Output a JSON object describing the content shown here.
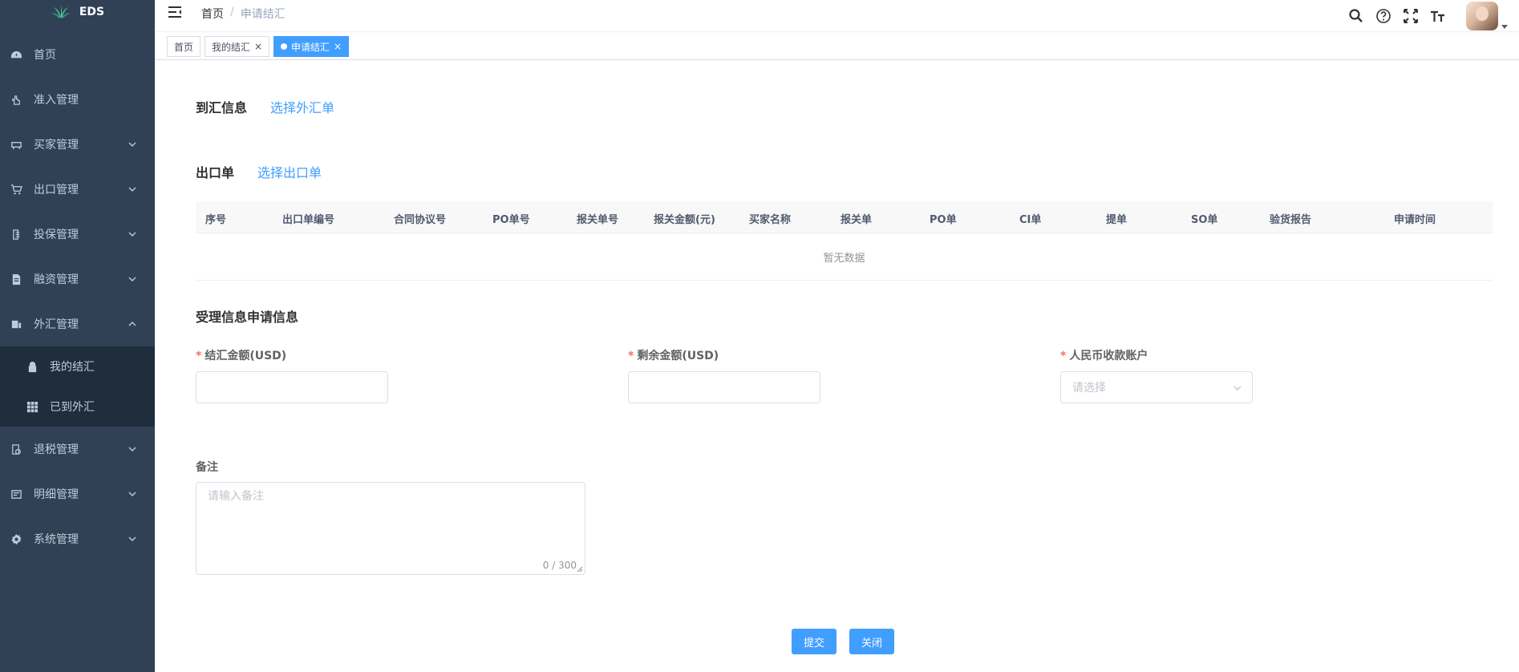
{
  "app": {
    "logo_text": "EDS"
  },
  "sidebar": {
    "items": [
      {
        "label": "首页",
        "icon": "dashboard-icon",
        "has_children": false
      },
      {
        "label": "准入管理",
        "icon": "hand-icon",
        "has_children": false
      },
      {
        "label": "买家管理",
        "icon": "buyer-icon",
        "has_children": true
      },
      {
        "label": "出口管理",
        "icon": "cart-icon",
        "has_children": true
      },
      {
        "label": "投保管理",
        "icon": "insurance-icon",
        "has_children": true
      },
      {
        "label": "融资管理",
        "icon": "document-icon",
        "has_children": true
      },
      {
        "label": "外汇管理",
        "icon": "forex-icon",
        "has_children": true,
        "expanded": true
      },
      {
        "label": "退税管理",
        "icon": "tax-refund-icon",
        "has_children": true
      },
      {
        "label": "明细管理",
        "icon": "detail-icon",
        "has_children": true
      },
      {
        "label": "系统管理",
        "icon": "settings-icon",
        "has_children": true
      }
    ],
    "forex_children": [
      {
        "label": "我的结汇",
        "icon": "lock-icon"
      },
      {
        "label": "已到外汇",
        "icon": "grid-icon"
      }
    ]
  },
  "navbar": {
    "breadcrumb": {
      "home": "首页",
      "separator": "/",
      "current": "申请结汇"
    },
    "icons": [
      "search-icon",
      "help-icon",
      "fullscreen-icon",
      "font-size-icon"
    ]
  },
  "tags": [
    {
      "label": "首页",
      "active": false,
      "closable": false
    },
    {
      "label": "我的结汇",
      "active": false,
      "closable": true
    },
    {
      "label": "申请结汇",
      "active": true,
      "closable": true
    }
  ],
  "main": {
    "arrival_section": {
      "title": "到汇信息",
      "link": "选择外汇单"
    },
    "export_section": {
      "title": "出口单",
      "link": "选择出口单"
    },
    "table": {
      "columns": [
        "序号",
        "出口单编号",
        "合同协议号",
        "PO单号",
        "报关单号",
        "报关金额(元)",
        "买家名称",
        "报关单",
        "PO单",
        "CI单",
        "提单",
        "SO单",
        "验货报告",
        "申请时间"
      ],
      "empty_text": "暂无数据"
    },
    "form_section": {
      "title": "受理信息申请信息"
    },
    "form": {
      "settle_amount": {
        "label": "结汇金额(USD)",
        "required": true,
        "value": ""
      },
      "remaining_amount": {
        "label": "剩余金额(USD)",
        "required": true,
        "value": ""
      },
      "rmb_account": {
        "label": "人民币收款账户",
        "required": true,
        "placeholder": "请选择"
      },
      "remark": {
        "label": "备注",
        "placeholder": "请输入备注",
        "counter": "0 / 300"
      }
    },
    "buttons": {
      "submit": "提交",
      "close": "关闭"
    }
  },
  "colors": {
    "sidebar_bg": "#304156",
    "submenu_bg": "#1f2d3d",
    "primary": "#409eff",
    "required": "#f56c6c"
  }
}
